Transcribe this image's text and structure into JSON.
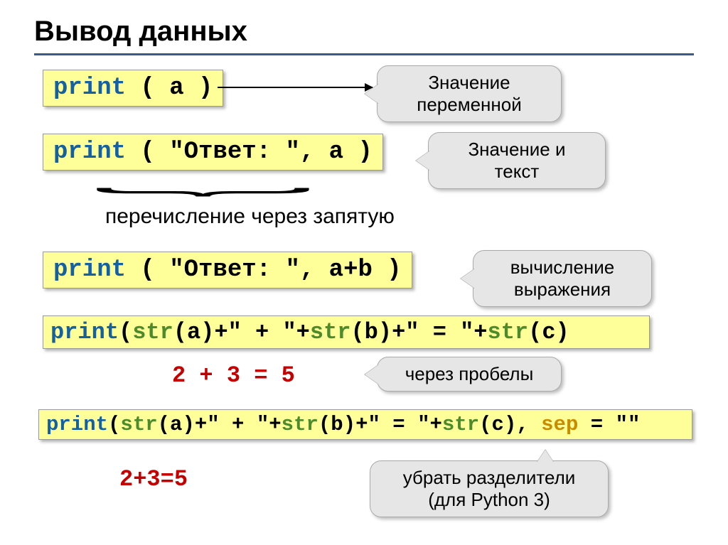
{
  "title": "Вывод данных",
  "rows": {
    "r1": {
      "code": {
        "print": "print",
        "rest": " ( a )"
      },
      "callout": "Значение\nпеременной"
    },
    "r2": {
      "code": {
        "print": "print",
        "rest": " ( \"Ответ: \", a )"
      },
      "callout": "Значение и\nтекст"
    },
    "brace_label": "перечисление через запятую",
    "r3": {
      "code": {
        "print": "print",
        "rest": " ( \"Ответ: \", a+b )"
      },
      "callout": "вычисление\nвыражения"
    },
    "r4": {
      "code_html": "print(str(a)+\" + \"+str(b)+\" = \"+str(c)"
    },
    "r5": {
      "red": "2 + 3 = 5",
      "callout": "через пробелы"
    },
    "r6": {
      "code_html": "print(str(a)+\" + \"+str(b)+\" = \"+str(c), sep = \"\""
    },
    "r7": {
      "red": "2+3=5",
      "callout": "убрать разделители\n(для Python 3)"
    }
  }
}
